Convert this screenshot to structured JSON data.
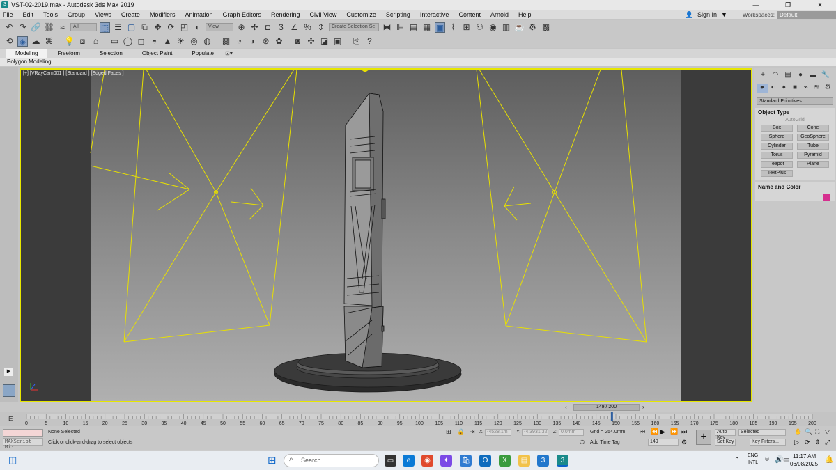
{
  "window": {
    "title": "VST-02-2019.max - Autodesk 3ds Max 2019",
    "controls": [
      "—",
      "❐",
      "✕"
    ]
  },
  "menu": {
    "items": [
      "File",
      "Edit",
      "Tools",
      "Group",
      "Views",
      "Create",
      "Modifiers",
      "Animation",
      "Graph Editors",
      "Rendering",
      "Civil View",
      "Customize",
      "Scripting",
      "Interactive",
      "Content",
      "Arnold",
      "Help"
    ],
    "sign_in": "Sign In",
    "workspaces_label": "Workspaces:",
    "workspace_value": "Default"
  },
  "toolbar": {
    "selection_filter": "All",
    "reference_coord": "View",
    "named_selection": "Create Selection Se"
  },
  "ribbon": {
    "tabs": [
      "Modeling",
      "Freeform",
      "Selection",
      "Object Paint",
      "Populate"
    ],
    "sub_label": "Polygon Modeling"
  },
  "viewport": {
    "label": "[+] [VRayCam001 ] [Standard ] [Edged Faces ]",
    "frame_color": "#e6e600",
    "light_color": "#e8e000"
  },
  "command_panel": {
    "dropdown": "Standard Primitives",
    "object_type_title": "Object Type",
    "autogrid": "AutoGrid",
    "buttons": [
      "Box",
      "Cone",
      "Sphere",
      "GeoSphere",
      "Cylinder",
      "Tube",
      "Torus",
      "Pyramid",
      "Teapot",
      "Plane",
      "TextPlus"
    ],
    "name_color_title": "Name and Color",
    "swatch_color": "#d62f8f"
  },
  "timeline": {
    "frame_display": "149 / 200",
    "ticks": [
      "0",
      "5",
      "10",
      "15",
      "20",
      "25",
      "30",
      "35",
      "40",
      "45",
      "50",
      "55",
      "60",
      "65",
      "70",
      "75",
      "80",
      "85",
      "90",
      "95",
      "100",
      "105",
      "110",
      "115",
      "120",
      "125",
      "130",
      "135",
      "140",
      "145",
      "150",
      "155",
      "160",
      "165",
      "170",
      "175",
      "180",
      "185",
      "190",
      "195",
      "200"
    ],
    "current_frame": 149
  },
  "status": {
    "maxscript": "MAXScript Mi:",
    "selection": "None Selected",
    "prompt": "Click or click-and-drag to select objects",
    "x_label": "X:",
    "x_value": "-4528.1m",
    "y_label": "Y:",
    "y_value": "-4.3931.32",
    "z_label": "Z:",
    "z_value": "0.0mm",
    "grid": "Grid = 254.0mm",
    "add_time_tag": "Add Time Tag",
    "frame_field": "149",
    "auto_key": "Auto Key",
    "set_key": "Set Key",
    "key_mode": "Selected",
    "key_filters": "Key Filters..."
  },
  "taskbar": {
    "search_placeholder": "Search",
    "lang_1": "ENG",
    "lang_2": "INTL",
    "time": "11:17 AM",
    "date": "06/08/2025"
  }
}
